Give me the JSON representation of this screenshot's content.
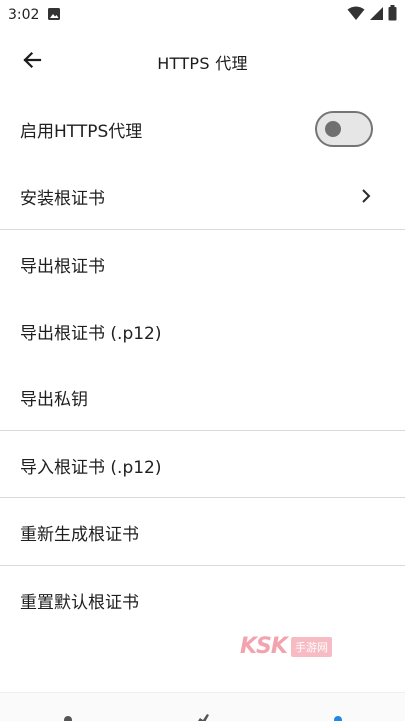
{
  "status_bar": {
    "time": "3:02"
  },
  "app_bar": {
    "title": "HTTPS 代理"
  },
  "settings": {
    "enable_https_proxy": {
      "label": "启用HTTPS代理",
      "enabled": false
    },
    "install_root_cert": {
      "label": "安装根证书"
    },
    "export_root_cert": {
      "label": "导出根证书"
    },
    "export_root_cert_p12": {
      "label": "导出根证书 (.p12)"
    },
    "export_private_key": {
      "label": "导出私钥"
    },
    "import_root_cert_p12": {
      "label": "导入根证书 (.p12)"
    },
    "regenerate_root_cert": {
      "label": "重新生成根证书"
    },
    "reset_default_root_cert": {
      "label": "重置默认根证书"
    }
  },
  "watermark": {
    "logo": "KSK",
    "text": "手游网"
  },
  "colors": {
    "toggle_track": "#e6e6e6",
    "toggle_border": "#757575",
    "divider": "#d9d9d9",
    "nav_active": "#1e88e5"
  },
  "icons": [
    "image-icon",
    "wifi-icon",
    "signal-icon",
    "battery-icon",
    "back-arrow-icon",
    "chevron-right-icon"
  ]
}
